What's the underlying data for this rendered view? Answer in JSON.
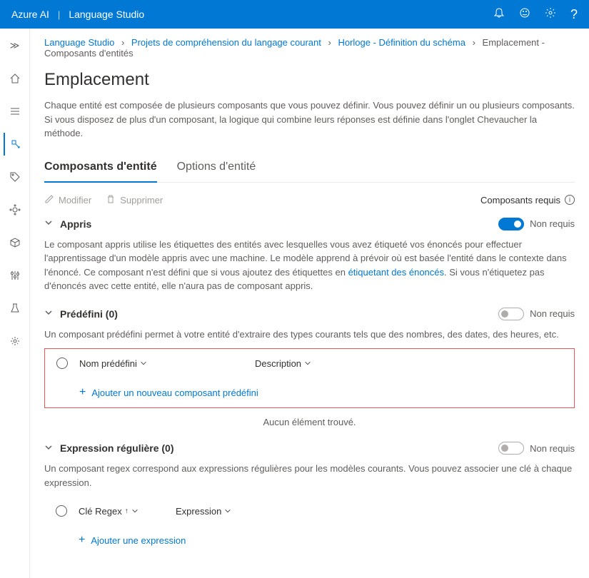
{
  "header": {
    "brand": "Azure AI",
    "title": "Language Studio"
  },
  "breadcrumb": {
    "items": [
      "Language Studio",
      "Projets de compréhension du langage courant",
      "Horloge - Définition du schéma"
    ],
    "current": "Emplacement - Composants d'entités"
  },
  "page": {
    "title": "Emplacement",
    "description": "Chaque entité est composée de plusieurs composants que vous pouvez définir. Vous pouvez définir un ou plusieurs composants. Si vous disposez de plus d'un composant, la logique qui combine leurs réponses est définie dans l'onglet Chevaucher la méthode."
  },
  "tabs": {
    "entity_components": "Composants d'entité",
    "entity_options": "Options d'entité"
  },
  "toolbar": {
    "modify": "Modifier",
    "delete": "Supprimer",
    "required_components": "Composants requis"
  },
  "sections": {
    "learned": {
      "title": "Appris",
      "toggle_label": "Non requis",
      "description_1": "Le composant appris utilise les étiquettes des entités avec lesquelles vous avez étiqueté vos énoncés pour effectuer l'apprentissage d'un modèle appris avec une machine. Le modèle apprend à prévoir où est basée l'entité dans le contexte dans l'énoncé. Ce composant n'est défini que si vous ajoutez des étiquettes en ",
      "link": "étiquetant des énoncés",
      "description_2": ". Si vous n'étiquetez pas d'énoncés avec cette entité, elle n'aura pas de composant appris."
    },
    "predef": {
      "title": "Prédéfini (0)",
      "toggle_label": "Non requis",
      "description": "Un composant prédéfini permet à votre entité d'extraire des types courants tels que des nombres, des dates, des heures, etc.",
      "col_name": "Nom prédéfini",
      "col_desc": "Description",
      "add_label": "Ajouter un nouveau composant prédéfini",
      "empty": "Aucun élément trouvé."
    },
    "regex": {
      "title": "Expression régulière (0)",
      "toggle_label": "Non requis",
      "description": "Un composant regex correspond aux expressions régulières pour les modèles courants. Vous pouvez associer une clé à chaque expression.",
      "col_key": "Clé Regex",
      "col_expr": "Expression",
      "add_label": "Ajouter une expression"
    }
  }
}
